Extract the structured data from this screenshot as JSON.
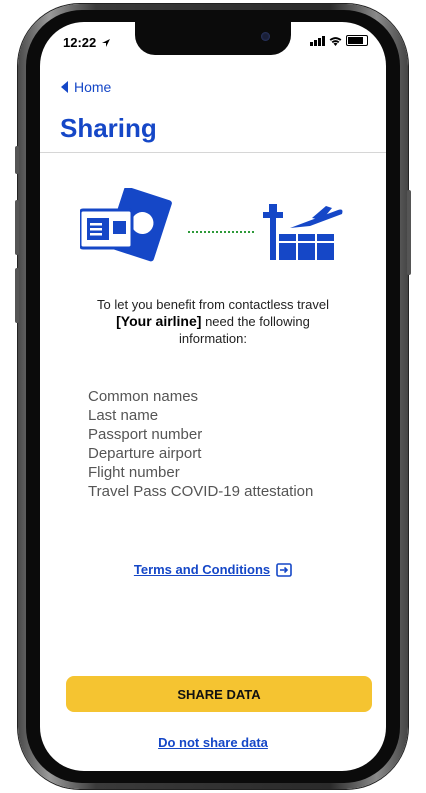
{
  "status_bar": {
    "time": "12:22"
  },
  "nav": {
    "back_label": "Home"
  },
  "header": {
    "title": "Sharing"
  },
  "intro": {
    "line1": "To let you benefit from contactless travel",
    "airline": "[Your airline]",
    "line2": "need the following",
    "line3": "information:"
  },
  "info_items": [
    "Common names",
    "Last name",
    "Passport number",
    "Departure airport",
    "Flight number",
    "Travel Pass COVID-19 attestation"
  ],
  "terms_label": "Terms and Conditions",
  "share_button_label": "SHARE DATA",
  "decline_label": "Do not share data",
  "colors": {
    "brand_blue": "#1547c7",
    "accent_yellow": "#f5c431"
  },
  "icons": [
    "back-arrow-icon",
    "passport-icon",
    "airport-tower-icon",
    "airplane-icon",
    "external-link-icon",
    "signal-icon",
    "wifi-icon",
    "battery-icon",
    "location-arrow-icon"
  ]
}
